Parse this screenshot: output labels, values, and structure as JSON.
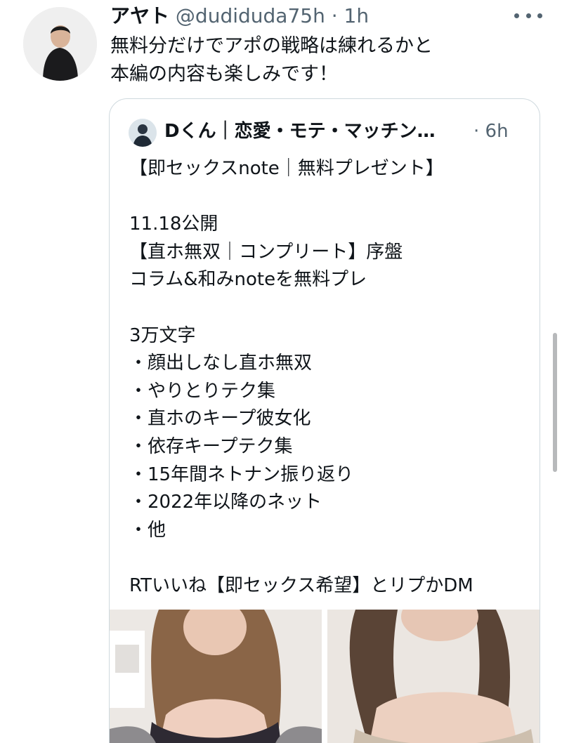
{
  "tweet": {
    "author_name": "アヤト",
    "author_handle_time": "@dudiduda75h · 1h",
    "text": "無料分だけでアポの戦略は練れるかと\n本編の内容も楽しみです！"
  },
  "quoted_tweet": {
    "author_name": "Dくん｜恋愛・モテ・マッチン…",
    "time": "· 6h",
    "text": "【即セックスnote｜無料プレゼント】\n\n11.18公開\n【直ホ無双｜コンプリート】序盤\nコラム&和みnoteを無料プレ\n\n3万文字\n・顔出しなし直ホ無双\n・やりとりテク集\n・直ホのキープ彼女化\n・依存キープテク集\n・15年間ネトナン振り返り\n・2022年以降のネット\n・他\n\nRTいいね【即セックス希望】とリプかDM"
  },
  "icons": {
    "more": "more-horizontal-icon"
  },
  "colors": {
    "text_primary": "#0f1419",
    "text_secondary": "#536471",
    "border": "#cfd9de"
  }
}
